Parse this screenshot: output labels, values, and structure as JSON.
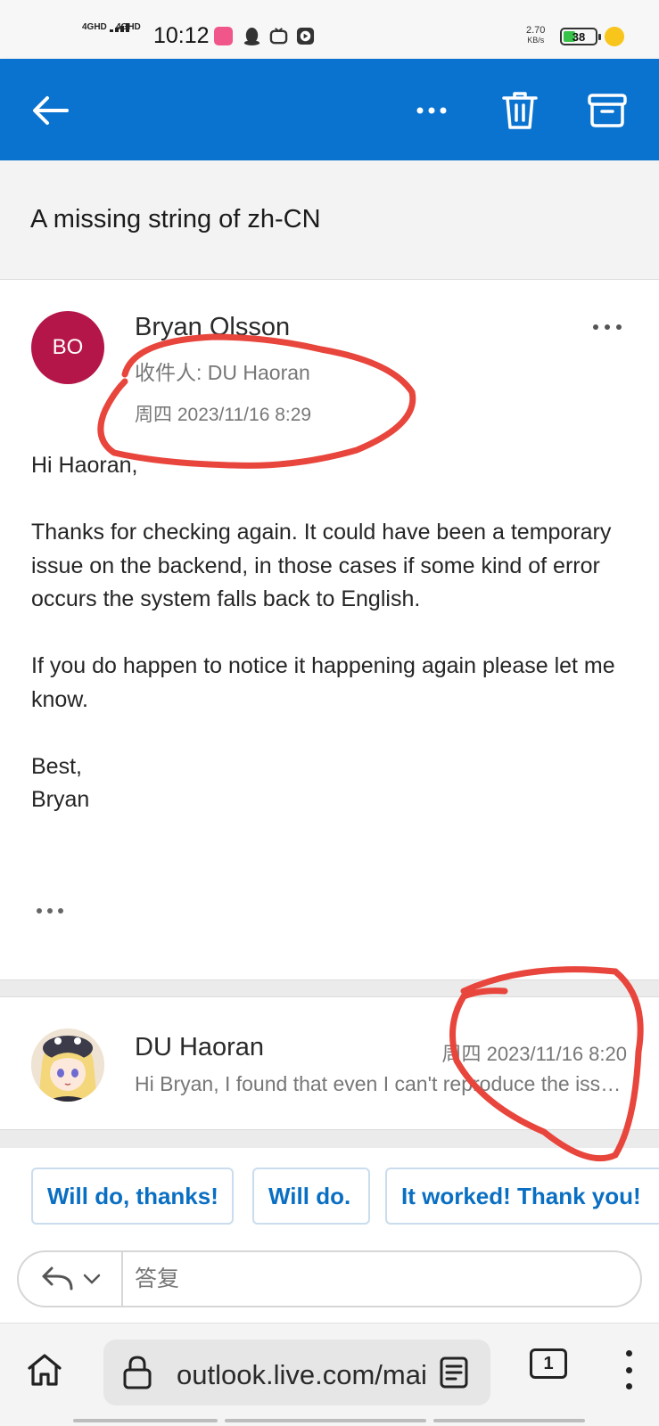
{
  "status_bar": {
    "network1": "4GHD",
    "network2": "4GHD",
    "time": "10:12",
    "speed_value": "2.70",
    "speed_unit": "KB/s",
    "battery_level": "38",
    "battery_color": "#39c24a"
  },
  "app_bar": {
    "background": "#0a73d0",
    "back_icon": "arrow-left-icon",
    "more_icon": "more-horizontal-icon",
    "delete_icon": "trash-icon",
    "archive_icon": "archive-icon"
  },
  "subject": "A missing string of zh-CN",
  "message": {
    "avatar_initials": "BO",
    "avatar_color": "#b5164a",
    "sender": "Bryan Olsson",
    "to_line": "收件人: DU Haoran",
    "date": "周四 2023/11/16 8:29",
    "greeting": "Hi Haoran,",
    "paragraph1": "Thanks for checking again. It could have been a temporary issue on the backend, in those cases if some kind of error occurs the system falls back to English.",
    "paragraph2": "If you do happen to notice it happening again please let me know.",
    "signoff": "Best,",
    "signature": "Bryan"
  },
  "previous_message": {
    "sender": "DU Haoran",
    "date": "周四 2023/11/16 8:20",
    "preview": "Hi Bryan, I found that even I can't reproduce the issue..."
  },
  "quick_replies": [
    "Will do, thanks!",
    "Will do.",
    "It worked! Thank you!"
  ],
  "reply": {
    "placeholder": "答复"
  },
  "browser": {
    "url": "outlook.live.com/mail",
    "tab_count": "1"
  },
  "annotation_color": "#e8453c"
}
